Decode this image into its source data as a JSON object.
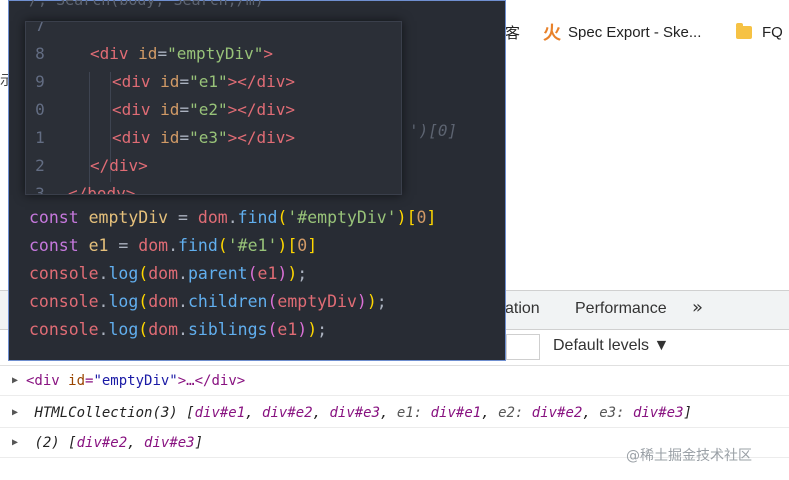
{
  "bookmarks": {
    "partial_label": "客",
    "spec_label": "Spec Export - Ske...",
    "fq_label": "FQ"
  },
  "page": {
    "left_edge_glyph": "示"
  },
  "devtools": {
    "tab_partial": "ation",
    "tab_performance": "Performance",
    "more_tabs": "»",
    "levels_label": "Default levels ▼"
  },
  "overlay": {
    "top_partial": "/, Search(body, Search,/m)",
    "ghost_text": "')[0]",
    "html_lines": [
      {
        "num": "7",
        "text": ""
      },
      {
        "num": "8",
        "open": "<div",
        "attr": " id",
        "eq": "=",
        "val": "\"emptyDiv\"",
        "close": ">"
      },
      {
        "num": "9",
        "open": "<div",
        "attr": " id",
        "eq": "=",
        "val": "\"e1\"",
        "close": "></div>"
      },
      {
        "num": "0",
        "open": "<div",
        "attr": " id",
        "eq": "=",
        "val": "\"e2\"",
        "close": "></div>"
      },
      {
        "num": "1",
        "open": "<div",
        "attr": " id",
        "eq": "=",
        "val": "\"e3\"",
        "close": "></div>"
      },
      {
        "num": "2",
        "open": "</div",
        "close": ">"
      },
      {
        "num": "3",
        "open": "</body",
        "close": ">"
      }
    ],
    "js_lines": [
      {
        "tokens": [
          {
            "t": "const ",
            "c": "k"
          },
          {
            "t": "emptyDiv",
            "c": "v"
          },
          {
            "t": " = ",
            "c": "p"
          },
          {
            "t": "dom",
            "c": "d"
          },
          {
            "t": ".",
            "c": "p"
          },
          {
            "t": "find",
            "c": "m"
          },
          {
            "t": "(",
            "c": "br1"
          },
          {
            "t": "'#emptyDiv'",
            "c": "s"
          },
          {
            "t": ")",
            "c": "br1"
          },
          {
            "t": "[",
            "c": "br1"
          },
          {
            "t": "0",
            "c": "n"
          },
          {
            "t": "]",
            "c": "br1"
          }
        ]
      },
      {
        "tokens": [
          {
            "t": "const ",
            "c": "k"
          },
          {
            "t": "e1",
            "c": "v"
          },
          {
            "t": " = ",
            "c": "p"
          },
          {
            "t": "dom",
            "c": "d"
          },
          {
            "t": ".",
            "c": "p"
          },
          {
            "t": "find",
            "c": "m"
          },
          {
            "t": "(",
            "c": "br1"
          },
          {
            "t": "'#e1'",
            "c": "s"
          },
          {
            "t": ")",
            "c": "br1"
          },
          {
            "t": "[",
            "c": "br1"
          },
          {
            "t": "0",
            "c": "n"
          },
          {
            "t": "]",
            "c": "br1"
          }
        ]
      },
      {
        "tokens": [
          {
            "t": "console",
            "c": "d"
          },
          {
            "t": ".",
            "c": "p"
          },
          {
            "t": "log",
            "c": "m"
          },
          {
            "t": "(",
            "c": "br1"
          },
          {
            "t": "dom",
            "c": "d"
          },
          {
            "t": ".",
            "c": "p"
          },
          {
            "t": "parent",
            "c": "m"
          },
          {
            "t": "(",
            "c": "br2"
          },
          {
            "t": "e1",
            "c": "d"
          },
          {
            "t": ")",
            "c": "br2"
          },
          {
            "t": ")",
            "c": "br1"
          },
          {
            "t": ";",
            "c": "p"
          }
        ]
      },
      {
        "tokens": [
          {
            "t": "console",
            "c": "d"
          },
          {
            "t": ".",
            "c": "p"
          },
          {
            "t": "log",
            "c": "m"
          },
          {
            "t": "(",
            "c": "br1"
          },
          {
            "t": "dom",
            "c": "d"
          },
          {
            "t": ".",
            "c": "p"
          },
          {
            "t": "children",
            "c": "m"
          },
          {
            "t": "(",
            "c": "br2"
          },
          {
            "t": "emptyDiv",
            "c": "d"
          },
          {
            "t": ")",
            "c": "br2"
          },
          {
            "t": ")",
            "c": "br1"
          },
          {
            "t": ";",
            "c": "p"
          }
        ]
      },
      {
        "tokens": [
          {
            "t": "console",
            "c": "d"
          },
          {
            "t": ".",
            "c": "p"
          },
          {
            "t": "log",
            "c": "m"
          },
          {
            "t": "(",
            "c": "br1"
          },
          {
            "t": "dom",
            "c": "d"
          },
          {
            "t": ".",
            "c": "p"
          },
          {
            "t": "siblings",
            "c": "m"
          },
          {
            "t": "(",
            "c": "br2"
          },
          {
            "t": "e1",
            "c": "d"
          },
          {
            "t": ")",
            "c": "br2"
          },
          {
            "t": ")",
            "c": "br1"
          },
          {
            "t": ";",
            "c": "p"
          }
        ]
      }
    ]
  },
  "console": {
    "row1": {
      "open": "<div",
      "attr": " id",
      "eq": "=",
      "val": "\"emptyDiv\"",
      "rest": ">…</div>"
    },
    "row2": {
      "parts": [
        {
          "t": "HTMLCollection(3) [",
          "c": "c-obj"
        },
        {
          "t": "div#e1",
          "c": "c-link"
        },
        {
          "t": ", ",
          "c": "c-obj"
        },
        {
          "t": "div#e2",
          "c": "c-link"
        },
        {
          "t": ", ",
          "c": "c-obj"
        },
        {
          "t": "div#e3",
          "c": "c-link"
        },
        {
          "t": ", ",
          "c": "c-obj"
        },
        {
          "t": "e1: ",
          "c": "c-key"
        },
        {
          "t": "div#e1",
          "c": "c-link"
        },
        {
          "t": ", ",
          "c": "c-obj"
        },
        {
          "t": "e2: ",
          "c": "c-key"
        },
        {
          "t": "div#e2",
          "c": "c-link"
        },
        {
          "t": ", ",
          "c": "c-obj"
        },
        {
          "t": "e3: ",
          "c": "c-key"
        },
        {
          "t": "div#e3",
          "c": "c-link"
        },
        {
          "t": "]",
          "c": "c-obj"
        }
      ]
    },
    "row3": {
      "parts": [
        {
          "t": "(2) [",
          "c": "c-obj"
        },
        {
          "t": "div#e2",
          "c": "c-link"
        },
        {
          "t": ", ",
          "c": "c-obj"
        },
        {
          "t": "div#e3",
          "c": "c-link"
        },
        {
          "t": "]",
          "c": "c-obj"
        }
      ]
    }
  },
  "watermark": "@稀土掘金技术社区"
}
